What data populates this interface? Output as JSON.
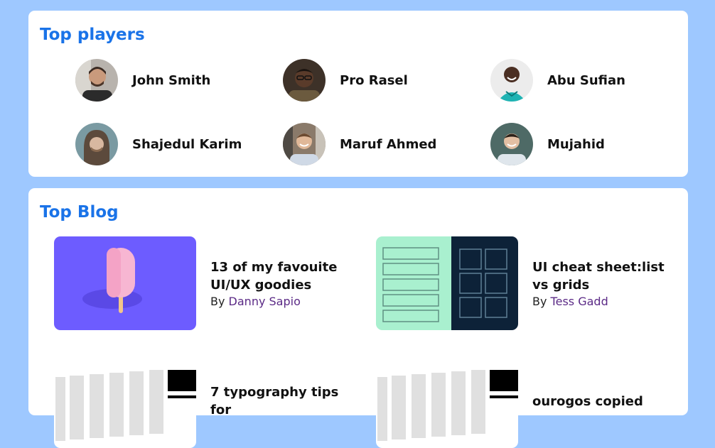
{
  "players_section": {
    "title": "Top players",
    "players": [
      {
        "name": "John Smith",
        "avatar_icon": "person-photo-icon"
      },
      {
        "name": "Pro Rasel",
        "avatar_icon": "person-photo-icon"
      },
      {
        "name": "Abu Sufian",
        "avatar_icon": "person-photo-icon"
      },
      {
        "name": "Shajedul Karim",
        "avatar_icon": "person-photo-icon"
      },
      {
        "name": "Maruf Ahmed",
        "avatar_icon": "person-photo-icon"
      },
      {
        "name": "Mujahid",
        "avatar_icon": "person-photo-icon"
      }
    ]
  },
  "blog_section": {
    "title": "Top Blog",
    "by_label": "By",
    "posts": [
      {
        "title": "13 of my favouite UI/UX goodies",
        "author": "Danny Sapio"
      },
      {
        "title": "UI cheat sheet:list vs grids",
        "author": "Tess Gadd"
      },
      {
        "title": "7 typography tips for",
        "author": ""
      },
      {
        "title": "ourogos copied",
        "author": ""
      }
    ]
  },
  "colors": {
    "page_background": "#9ec8ff",
    "card_background": "#ffffff",
    "accent": "#1a73e8",
    "author_link": "#5b2a86"
  }
}
